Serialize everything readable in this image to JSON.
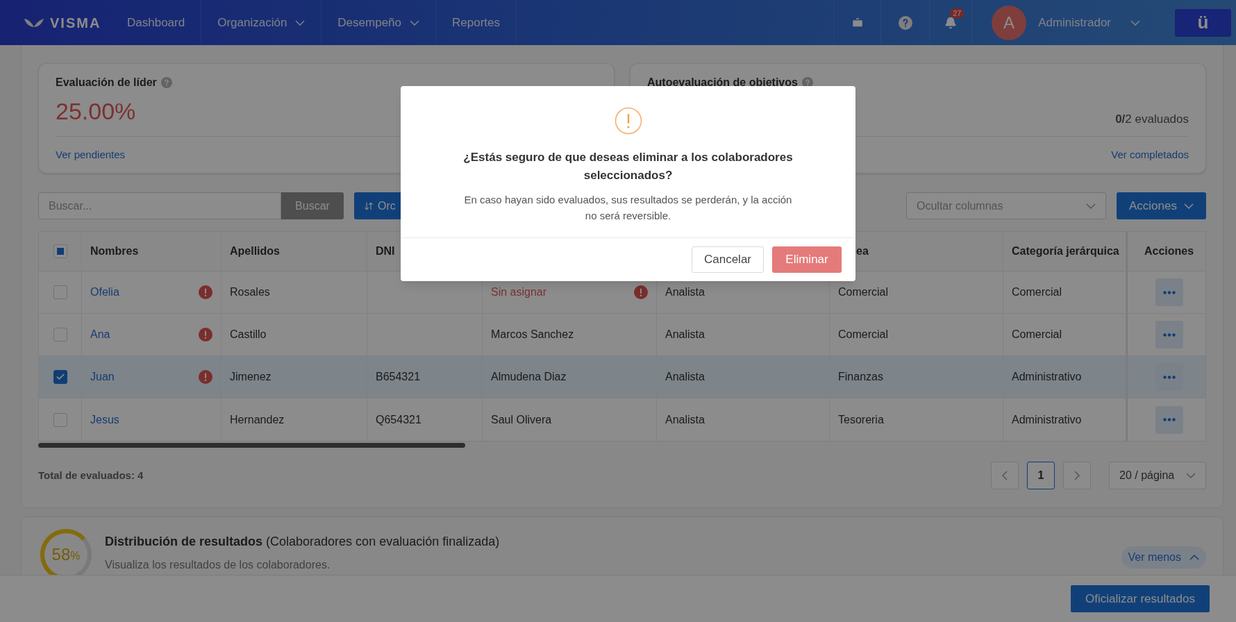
{
  "navbar": {
    "logo": "VISMA",
    "menu": [
      {
        "label": "Dashboard",
        "dropdown": false
      },
      {
        "label": "Organización",
        "dropdown": true
      },
      {
        "label": "Desempeño",
        "dropdown": true
      },
      {
        "label": "Reportes",
        "dropdown": false
      }
    ],
    "notifications_badge": "27",
    "user": {
      "avatar_letter": "A",
      "name": "Administrador"
    },
    "app_button": "ü"
  },
  "metrics": [
    {
      "kind": "percent",
      "title": "Evaluación de líder",
      "value": "25.00%",
      "link": "Ver pendientes"
    },
    {
      "kind": "count",
      "title": "Autoevaluación de objetivos",
      "value": "**0/**2 evaluados",
      "link": "Ver completados"
    }
  ],
  "toolbar": {
    "search_placeholder": "Buscar...",
    "search_button": "Buscar",
    "sort_button": "Orc",
    "columns_placeholder": "Ocultar columnas",
    "actions_button": "Acciones"
  },
  "table": {
    "select_all_indeterminate": true,
    "headers": [
      "Nombres",
      "Apellidos",
      "DNI",
      "ea",
      "Categoría jerárquica",
      "Acciones"
    ],
    "rows": [
      {
        "nombre": "Ofelia",
        "warning": true,
        "apellido": "Rosales",
        "evaluador": "Sin asignar",
        "evaluador_missing": true,
        "cargo": "Analista",
        "area": "Comercial",
        "categoria": "Comercial",
        "selected": false
      },
      {
        "nombre": "Ana",
        "warning": true,
        "apellido": "Castillo",
        "evaluador": "Marcos Sanchez",
        "evaluador_missing": false,
        "cargo": "Analista",
        "area": "Comercial",
        "categoria": "Comercial",
        "selected": false
      },
      {
        "nombre": "Juan",
        "warning": true,
        "apellido": "Jimenez",
        "dni": "B654321",
        "evaluador": "Almudena Diaz",
        "evaluador_missing": false,
        "cargo": "Analista",
        "area": "Finanzas",
        "categoria": "Administrativo",
        "selected": true
      },
      {
        "nombre": "Jesus",
        "warning": false,
        "apellido": "Hernandez",
        "dni": "Q654321",
        "evaluador": "Saul Olivera",
        "evaluador_missing": false,
        "cargo": "Analista",
        "area": "Tesoreria",
        "categoria": "Administrativo",
        "selected": false
      }
    ]
  },
  "total": "Total de evaluados: 4",
  "pagination": {
    "pages": [
      {
        "label": "1",
        "selected": true
      }
    ],
    "page_size": "20 / página"
  },
  "distribution": {
    "level": 0.58,
    "value": "58",
    "unit": "%",
    "title": "**Distribución de resultados** (Colaboradores con evaluación finalizada)",
    "subtitle": "Visualiza los resultados de los colaboradores.",
    "toggle": "Ver menos"
  },
  "action_bar": {
    "button": "Oficializar resultados"
  },
  "dialog": {
    "title": "¿Estás seguro de que deseas eliminar a los colaboradores seleccionados?",
    "message": "En caso hayan sido evaluados, sus resultados se perderán, y la acción no será reversible.",
    "buttons": [
      {
        "label": "Cancelar",
        "kind": "secondary"
      },
      {
        "label": "Eliminar",
        "kind": "danger"
      }
    ]
  }
}
